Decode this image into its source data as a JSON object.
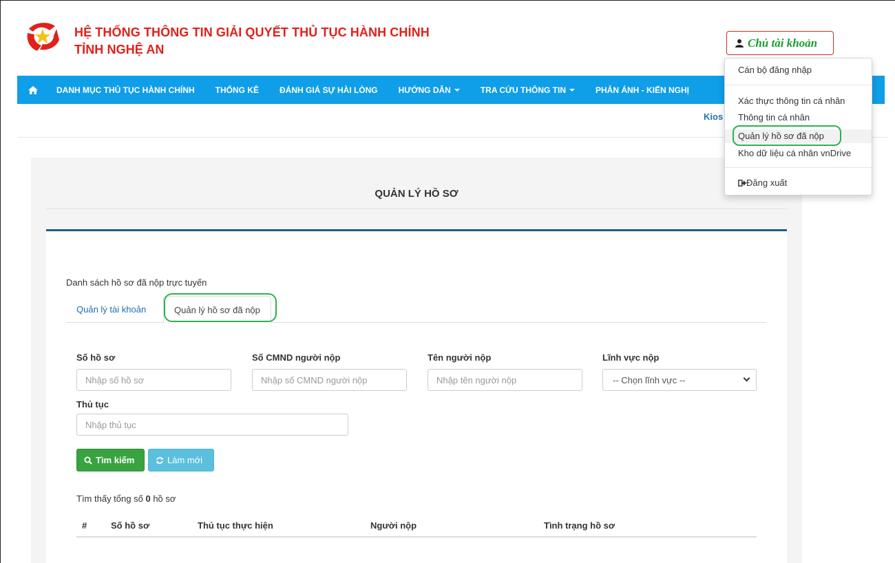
{
  "header": {
    "title_line1": "HỆ THỐNG THÔNG TIN GIẢI QUYẾT THỦ TỤC HÀNH CHÍNH",
    "title_line2": "TỈNH NGHỆ AN",
    "account_label": "Chủ tài khoản",
    "kiosk_label": "Kios"
  },
  "nav": {
    "items": [
      {
        "label": "DANH MỤC THỦ TỤC HÀNH CHÍNH"
      },
      {
        "label": "THỐNG KÊ"
      },
      {
        "label": "ĐÁNH GIÁ SỰ HÀI LÒNG"
      },
      {
        "label": "HƯỚNG DẪN"
      },
      {
        "label": "TRA CỨU THÔNG TIN"
      },
      {
        "label": "PHẢN ÁNH - KIẾN NGHỊ"
      }
    ]
  },
  "dropdown": {
    "items": [
      {
        "label": "Cán bộ đăng nhập"
      },
      {
        "label": "Xác thực thông tin cá nhân"
      },
      {
        "label": "Thông tin cá nhân"
      },
      {
        "label": "Quản lý hồ sơ đã nộp"
      },
      {
        "label": "Kho dữ liệu cá nhân vnDrive"
      },
      {
        "label": "Đăng xuất"
      }
    ]
  },
  "page": {
    "title": "QUẢN LÝ HỒ SƠ",
    "list_title": "Danh sách hồ sơ đã nộp trực tuyến",
    "tabs": [
      {
        "label": "Quản lý tài khoản"
      },
      {
        "label": "Quản lý hồ sơ đã nộp"
      }
    ]
  },
  "filters": {
    "so_ho_so": {
      "label": "Số hồ sơ",
      "placeholder": "Nhập số hồ sơ"
    },
    "cmnd": {
      "label": "Số CMND người nộp",
      "placeholder": "Nhập số CMND người nộp"
    },
    "ten": {
      "label": "Tên người nộp",
      "placeholder": "Nhập tên người nộp"
    },
    "linh_vuc": {
      "label": "Lĩnh vực nộp",
      "selected": "-- Chọn lĩnh vực --"
    },
    "thu_tuc": {
      "label": "Thủ tục",
      "placeholder": "Nhập thủ tục"
    }
  },
  "buttons": {
    "search": "Tìm kiếm",
    "reset": "Làm mới"
  },
  "results": {
    "prefix": "Tìm thấy tổng số",
    "count": "0",
    "suffix": "hồ sơ"
  },
  "table": {
    "columns": [
      "#",
      "Số hồ sơ",
      "Thủ tục thực hiện",
      "Người nộp",
      "Tình trạng hồ sơ"
    ]
  },
  "colors": {
    "nav_bg": "#0f9ee8",
    "title_red": "#e0211c",
    "highlight_green": "#2bb34a"
  }
}
